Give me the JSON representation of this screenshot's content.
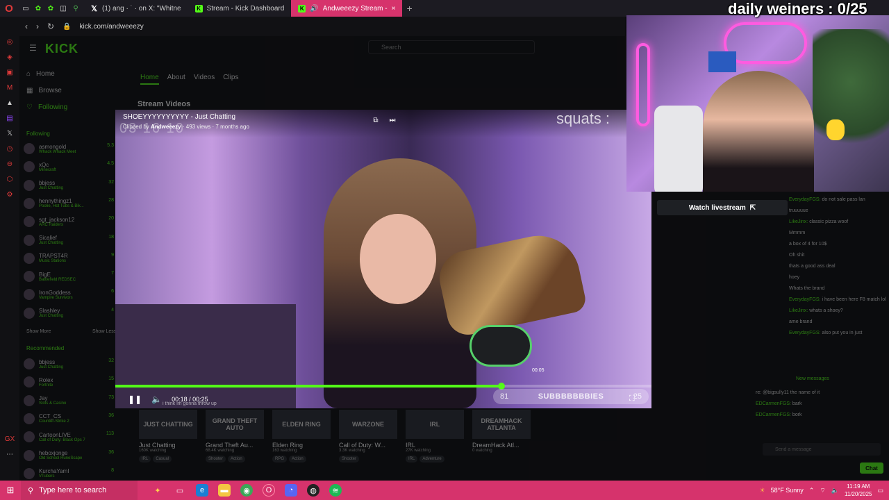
{
  "browser": {
    "tabs": [
      {
        "label": "(1) ang · ˙ · on X: \"Whitne",
        "icon": "x-logo-icon"
      },
      {
        "label": "Stream - Kick Dashboard",
        "icon": "kick-favicon-icon"
      },
      {
        "label": "Andweeezy Stream -",
        "icon": "kick-favicon-icon",
        "active": true
      }
    ],
    "url": "kick.com/andweeezy"
  },
  "kick": {
    "search_placeholder": "Search",
    "nav": [
      "Home",
      "Browse",
      "Following"
    ],
    "following_header": "Following",
    "following": [
      {
        "name": "asmongold",
        "category": "Whack Whack Meet",
        "viewers": "5.3"
      },
      {
        "name": "xQc",
        "category": "Minecraft",
        "viewers": "4.5"
      },
      {
        "name": "bbjess",
        "category": "Just Chatting",
        "viewers": "32"
      },
      {
        "name": "hennythingz1",
        "category": "Poolie, Hot Tubs & Bik...",
        "viewers": "28"
      },
      {
        "name": "sgt_jackson12",
        "category": "ARC Raiders",
        "viewers": "20"
      },
      {
        "name": "Sicalief",
        "category": "Just Chatting",
        "viewers": "18"
      },
      {
        "name": "TRAPST4R",
        "category": "Music Stations",
        "viewers": "9"
      },
      {
        "name": "BigE",
        "category": "Battlefield REDSEC",
        "viewers": "7"
      },
      {
        "name": "IronGoddess",
        "category": "Vampire Survivors",
        "viewers": "6"
      },
      {
        "name": "Slashley",
        "category": "Just Chatting",
        "viewers": "4"
      }
    ],
    "show_more": "Show More",
    "show_less": "Show Less",
    "recommended_header": "Recommended",
    "recommended": [
      {
        "name": "bbjess",
        "category": "Just Chatting",
        "viewers": "32"
      },
      {
        "name": "Rolex",
        "category": "Fortnite",
        "viewers": "15"
      },
      {
        "name": "Jay",
        "category": "Slots & Casino",
        "viewers": "73"
      },
      {
        "name": "CCT_CS",
        "category": "Counter-Strike 2",
        "viewers": "36"
      },
      {
        "name": "CartoonLIVE",
        "category": "Call of Duty: Black Ops 7",
        "viewers": "113"
      },
      {
        "name": "heboxjonge",
        "category": "Old School RuneScape",
        "viewers": "36"
      },
      {
        "name": "KurchaYamI",
        "category": "VTubers",
        "viewers": "8"
      }
    ],
    "profile_tabs": [
      "Home",
      "About",
      "Videos",
      "Clips"
    ],
    "section_title": "Stream Videos",
    "categories": [
      {
        "art": "JUST CHATTING",
        "title": "Just Chatting",
        "watching": "160K watching",
        "tags": [
          "IRL",
          "Casual"
        ]
      },
      {
        "art": "GRAND THEFT AUTO",
        "title": "Grand Theft Au...",
        "watching": "68.4K watching",
        "tags": [
          "Shooter",
          "Action"
        ]
      },
      {
        "art": "ELDEN RING",
        "title": "Elden Ring",
        "watching": "163 watching",
        "tags": [
          "RPG",
          "Action"
        ]
      },
      {
        "art": "WARZONE",
        "title": "Call of Duty: W...",
        "watching": "3.3K watching",
        "tags": [
          "Shooter"
        ]
      },
      {
        "art": "IRL",
        "title": "IRL",
        "watching": "27K watching",
        "tags": [
          "IRL",
          "Adventure"
        ]
      },
      {
        "art": "DREAMHACK ATLANTA",
        "title": "DreamHack Atl...",
        "watching": "0 watching",
        "tags": []
      }
    ],
    "watch_livestream": "Watch livestream"
  },
  "chat": {
    "messages": [
      {
        "user": "EverydayFGS:",
        "text": "do not sale pass lan"
      },
      {
        "user": "",
        "text": "truuuuue"
      },
      {
        "user": "LikeJinx:",
        "text": "classic pizza woof"
      },
      {
        "user": "",
        "text": "Mmmm"
      },
      {
        "user": "",
        "text": "a box of 4 for 10$"
      },
      {
        "user": "",
        "text": "Oh shit"
      },
      {
        "user": "",
        "text": "thats a good ass deal"
      },
      {
        "user": "",
        "text": "hoey"
      },
      {
        "user": "",
        "text": "Whats the brand"
      },
      {
        "user": "EverydayFGS:",
        "text": "i have been here F8 match lol"
      },
      {
        "user": "LikeJinx:",
        "text": "whats a shoey?"
      },
      {
        "user": "",
        "text": "ame brand"
      },
      {
        "user": "EverydayFGS:",
        "text": "also put you in just"
      }
    ],
    "new_messages": "New messages",
    "after": [
      {
        "user": "",
        "text": "re: @bigsully11 the name of it"
      },
      {
        "user": "EDCarmenFGS:",
        "text": "bark"
      },
      {
        "user": "EDCarmenFGS:",
        "text": "bork"
      }
    ],
    "input_placeholder": "Send a message",
    "send_label": "Chat"
  },
  "player": {
    "title": "SHOEYYYYYYYYYY - Just Chatting",
    "clipped_prefix": "Clipped by",
    "clipped_by": "Andweeezy",
    "meta": "· 493 views · 7 months ago",
    "overlay_counter": "squats :",
    "time": "00:18 / 00:25",
    "hover_time": "00:05",
    "progress": 0.72,
    "caption": "i think im gonna throw up",
    "sub_count": "81",
    "sub_label": "SUBBBBBBBIES",
    "sub_goal": "25"
  },
  "overlay": {
    "counter_text": "daily weiners : 0/25"
  },
  "taskbar": {
    "search_placeholder": "Type here to search",
    "weather": "58°F  Sunny",
    "time": "11:19 AM",
    "date": "11/20/2025"
  },
  "colors": {
    "kick_green": "#53fc18",
    "taskbar_pink": "#d6336c"
  }
}
